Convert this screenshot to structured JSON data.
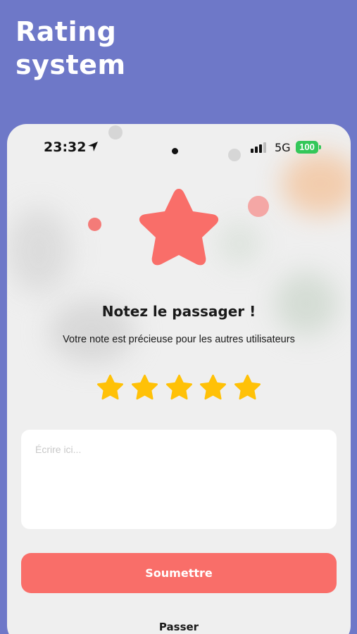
{
  "promo": {
    "heading_line1": "Rating",
    "heading_line2": "system"
  },
  "status_bar": {
    "time": "23:32",
    "network": "5G",
    "battery": "100",
    "icons": [
      "location-arrow-icon",
      "signal-bars-icon",
      "battery-icon"
    ]
  },
  "rating_screen": {
    "hero_icon": "star-icon",
    "title": "Notez le passager !",
    "subtitle": "Votre note est précieuse pour les autres utilisateurs",
    "stars_selected": 5,
    "stars_total": 5,
    "comment_placeholder": "Écrire ici...",
    "comment_value": "",
    "submit_label": "Soumettre",
    "skip_label": "Passer"
  },
  "colors": {
    "background": "#6e78c8",
    "card": "#efefef",
    "accent": "#f96e69",
    "star_filled": "#ffc107",
    "battery": "#34c759"
  }
}
